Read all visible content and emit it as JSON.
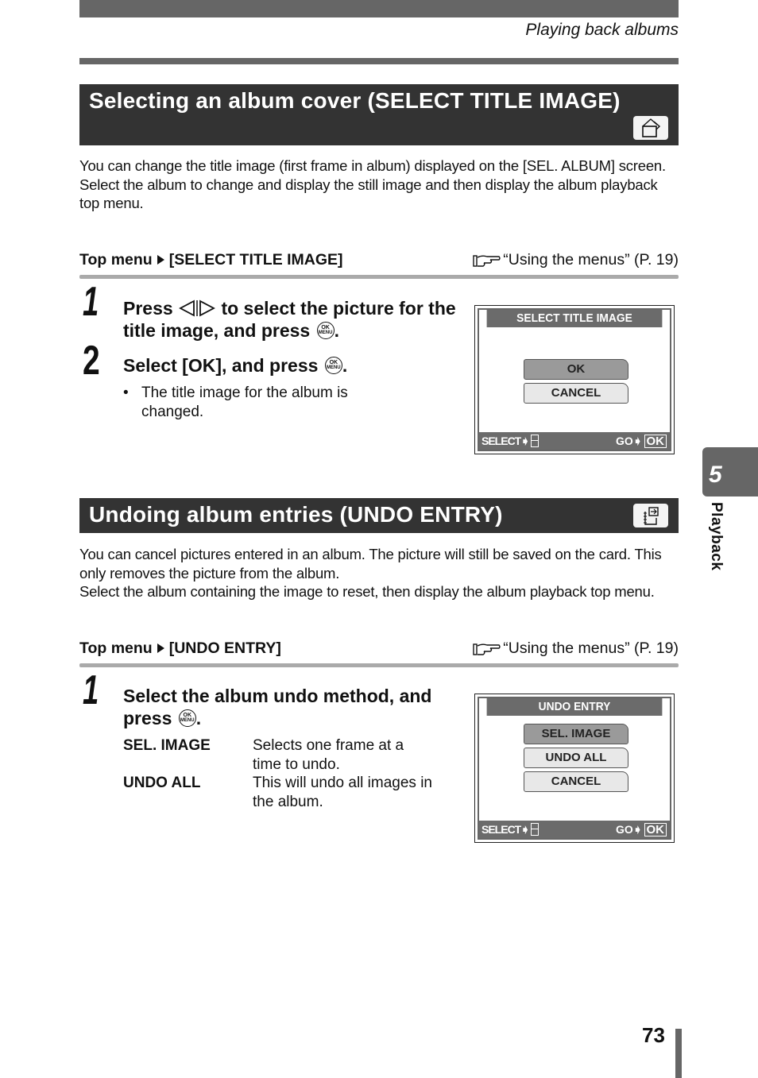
{
  "header": {
    "running_title": "Playing back albums"
  },
  "sections": [
    {
      "title": "Selecting an album cover (SELECT TITLE IMAGE)",
      "icon": "select-title-image-icon",
      "paragraphs": [
        "You can change the title image (first frame in album) displayed on the [SEL. ALBUM] screen.",
        "Select the album to change and display the still image and then display the album playback top menu."
      ],
      "top_menu": {
        "prefix": "Top menu",
        "item": "[SELECT TITLE IMAGE]",
        "reference": "“Using the menus” (P. 19)"
      },
      "steps": [
        {
          "number": "1",
          "text_before": "Press",
          "text_after_arrows": "to select the picture for the title image, and press",
          "end": "."
        },
        {
          "number": "2",
          "text": "Select [OK], and press",
          "end": "."
        }
      ],
      "bullets": [
        "The title image for the album is changed."
      ],
      "lcd": {
        "title": "SELECT TITLE IMAGE",
        "options": [
          "OK",
          "CANCEL"
        ],
        "selected": "OK",
        "footer_select": "SELECT",
        "footer_go": "GO",
        "footer_ok": "OK"
      }
    },
    {
      "title": "Undoing album entries (UNDO ENTRY)",
      "icon": "undo-entry-icon",
      "paragraphs": [
        "You can cancel pictures entered in an album. The picture will still be saved on the card. This only removes the picture from the album.",
        "Select the album containing the image to reset, then display the album playback top menu."
      ],
      "top_menu": {
        "prefix": "Top menu",
        "item": "[UNDO ENTRY]",
        "reference": "“Using the menus” (P. 19)"
      },
      "steps": [
        {
          "number": "1",
          "text": "Select the album undo method, and press",
          "end": "."
        }
      ],
      "definitions": [
        {
          "term": "SEL. IMAGE",
          "desc": "Selects one frame at a time to undo."
        },
        {
          "term": "UNDO ALL",
          "desc": "This will undo all images in the album."
        }
      ],
      "lcd": {
        "title": "UNDO ENTRY",
        "options": [
          "SEL. IMAGE",
          "UNDO ALL",
          "CANCEL"
        ],
        "selected": "SEL. IMAGE",
        "footer_select": "SELECT",
        "footer_go": "GO",
        "footer_ok": "OK"
      }
    }
  ],
  "ok_menu_button": {
    "top": "OK",
    "bottom": "MENU"
  },
  "side_tab": {
    "chapter": "5",
    "label": "Playback"
  },
  "footer": {
    "page_number": "73"
  }
}
